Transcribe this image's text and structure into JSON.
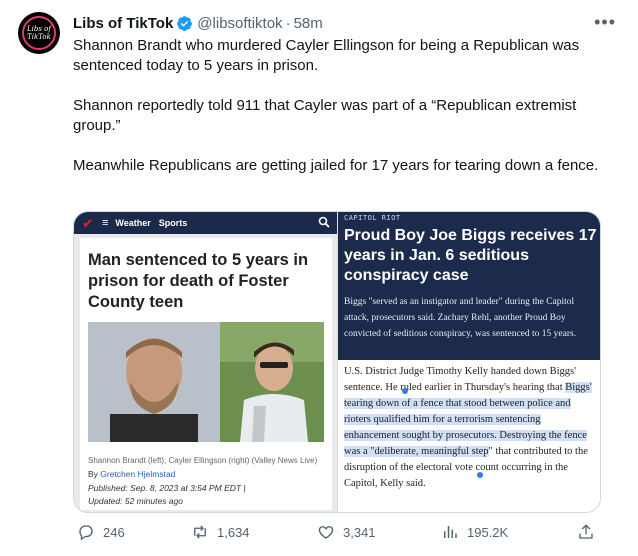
{
  "account": {
    "display_name": "Libs of TikTok",
    "handle": "@libsoftiktok",
    "separator": "·",
    "time": "58m",
    "avatar_text_line1": "Libs of",
    "avatar_text_line2": "TikTok"
  },
  "tweet": {
    "paragraphs": [
      "Shannon Brandt who murdered Cayler Ellingson for being a Republican was sentenced today to 5 years in prison.",
      "Shannon reportedly told 911 that Cayler was part of a “Republican extremist group.”",
      "Meanwhile Republicans are getting jailed for 17 years for tearing down a fence."
    ]
  },
  "left_article": {
    "nav": {
      "menu": "≡",
      "item1": "Weather",
      "item2": "Sports"
    },
    "headline": "Man sentenced to 5 years in prison for death of Foster County teen",
    "caption": "Shannon Brandt (left), Cayler Ellingson (right)  (Valley News Live)",
    "byline_prefix": "By ",
    "author": "Gretchen Hjelmstad",
    "published": "Published: Sep. 8, 2023 at 3:54 PM EDT  |",
    "updated": "Updated: 52 minutes ago"
  },
  "right_article": {
    "kicker": "CAPITOL RIOT",
    "headline": "Proud Boy Joe Biggs receives 17 years in Jan. 6 seditious conspiracy case",
    "summary": "Biggs \"served as an instigator and leader\" during the Capitol attack, prosecutors said. Zachary Rehl, another Proud Boy convicted of seditious conspiracy, was sentenced to 15 years.",
    "body_plain": "U.S. District Judge Timothy Kelly handed down Biggs' sentence. He ruled earlier in Thursday's hearing that ",
    "body_highlight": "Biggs' tearing down of a fence that stood between police and rioters qualified him for a terrorism sentencing enhancement sought by prosecutors. Destroying the fence was a \"deliberate, meaningful step",
    "body_tail": "\" that contributed to the disruption of the electoral vote count occurring in the Capitol, Kelly said."
  },
  "actions": {
    "replies": "246",
    "retweets": "1,634",
    "likes": "3,341",
    "views": "195.2K"
  },
  "colors": {
    "verified": "#1d9bf0",
    "text_secondary": "#536471",
    "navy": "#1c2b4b",
    "highlight": "#cfe0f8"
  },
  "icons": [
    "verified-badge-icon",
    "more-icon",
    "search-icon",
    "reply-icon",
    "retweet-icon",
    "like-icon",
    "views-icon",
    "share-icon"
  ]
}
